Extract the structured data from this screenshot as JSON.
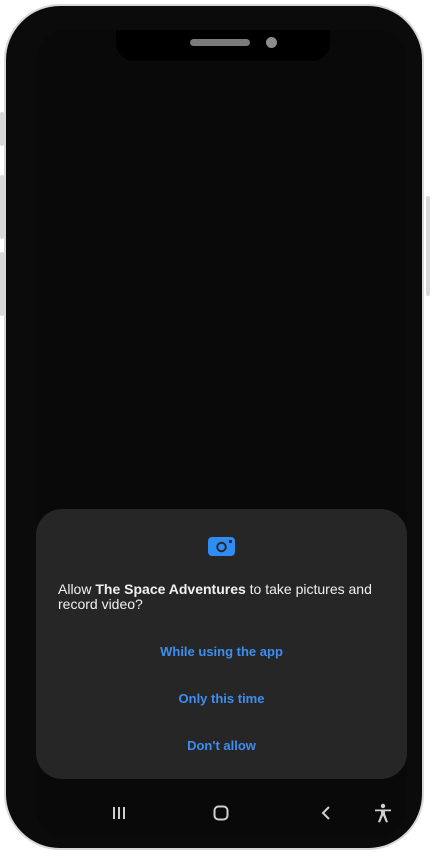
{
  "dialog": {
    "icon": "camera-icon",
    "message_prefix": "Allow ",
    "app_name": "The Space Adventures",
    "message_suffix": " to take pictures and record video?",
    "buttons": {
      "while_using": "While using the app",
      "only_this_time": "Only this time",
      "dont_allow": "Don't allow"
    },
    "accent_color": "#3d8ef0",
    "background_color": "#262626"
  },
  "navbar": {
    "items": [
      "recent-apps-icon",
      "home-icon",
      "back-icon",
      "accessibility-icon"
    ]
  },
  "device": {
    "frame_color": "#0b0b0b",
    "screen_color": "#090909"
  }
}
